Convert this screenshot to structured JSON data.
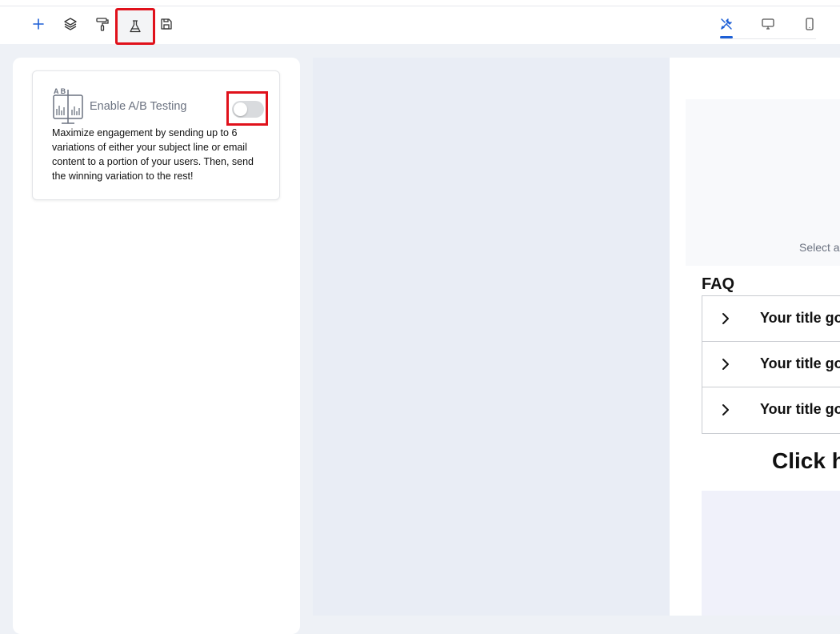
{
  "toolbar": {
    "buttons": [
      {
        "name": "add",
        "icon": "plus-icon"
      },
      {
        "name": "layers",
        "icon": "layers-icon"
      },
      {
        "name": "style",
        "icon": "paint-roller-icon"
      },
      {
        "name": "ab-testing",
        "icon": "flask-icon",
        "active": true
      },
      {
        "name": "save",
        "icon": "floppy-disk-icon"
      }
    ],
    "views": [
      {
        "name": "editor",
        "icon": "tools-icon",
        "active": true
      },
      {
        "name": "desktop",
        "icon": "monitor-icon"
      },
      {
        "name": "mobile",
        "icon": "phone-icon"
      }
    ],
    "accent_color": "#1d5fd6",
    "highlight_color": "#e0111b"
  },
  "ab_card": {
    "icon_letters": "A B",
    "title": "Enable A/B Testing",
    "toggle_enabled": false,
    "description": "Maximize engagement by sending up to 6 variations of either your subject line or email content to a portion of your users. Then, send the winning variation to the rest!"
  },
  "preview": {
    "select_text": "Select a",
    "faq_title": "FAQ",
    "faq_items": [
      "Your title go",
      "Your title go",
      "Your title go"
    ],
    "click_text": "Click h"
  }
}
